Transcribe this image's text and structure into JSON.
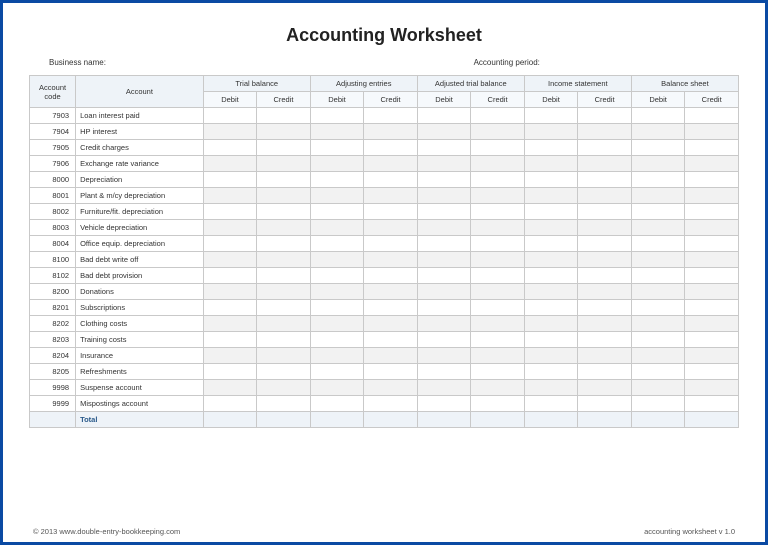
{
  "title": "Accounting Worksheet",
  "meta": {
    "business_label": "Business name:",
    "period_label": "Accounting period:"
  },
  "headers": {
    "code": "Account code",
    "account": "Account",
    "groups": [
      "Trial balance",
      "Adjusting entries",
      "Adjusted trial balance",
      "Income statement",
      "Balance sheet"
    ],
    "debit": "Debit",
    "credit": "Credit"
  },
  "rows": [
    {
      "code": "7903",
      "acct": "Loan interest paid"
    },
    {
      "code": "7904",
      "acct": "HP interest"
    },
    {
      "code": "7905",
      "acct": "Credit charges"
    },
    {
      "code": "7906",
      "acct": "Exchange rate variance"
    },
    {
      "code": "8000",
      "acct": "Depreciation"
    },
    {
      "code": "8001",
      "acct": "Plant & m/cy depreciation"
    },
    {
      "code": "8002",
      "acct": "Furniture/fit. depreciation"
    },
    {
      "code": "8003",
      "acct": "Vehicle depreciation"
    },
    {
      "code": "8004",
      "acct": "Office equip. depreciation"
    },
    {
      "code": "8100",
      "acct": "Bad debt write off"
    },
    {
      "code": "8102",
      "acct": "Bad debt provision"
    },
    {
      "code": "8200",
      "acct": "Donations"
    },
    {
      "code": "8201",
      "acct": "Subscriptions"
    },
    {
      "code": "8202",
      "acct": "Clothing costs"
    },
    {
      "code": "8203",
      "acct": "Training costs"
    },
    {
      "code": "8204",
      "acct": "Insurance"
    },
    {
      "code": "8205",
      "acct": "Refreshments"
    },
    {
      "code": "9998",
      "acct": "Suspense account"
    },
    {
      "code": "9999",
      "acct": "Mispostings account"
    }
  ],
  "total_label": "Total",
  "footer": {
    "copyright": "© 2013 www.double-entry-bookkeeping.com",
    "version": "accounting worksheet v 1.0"
  }
}
